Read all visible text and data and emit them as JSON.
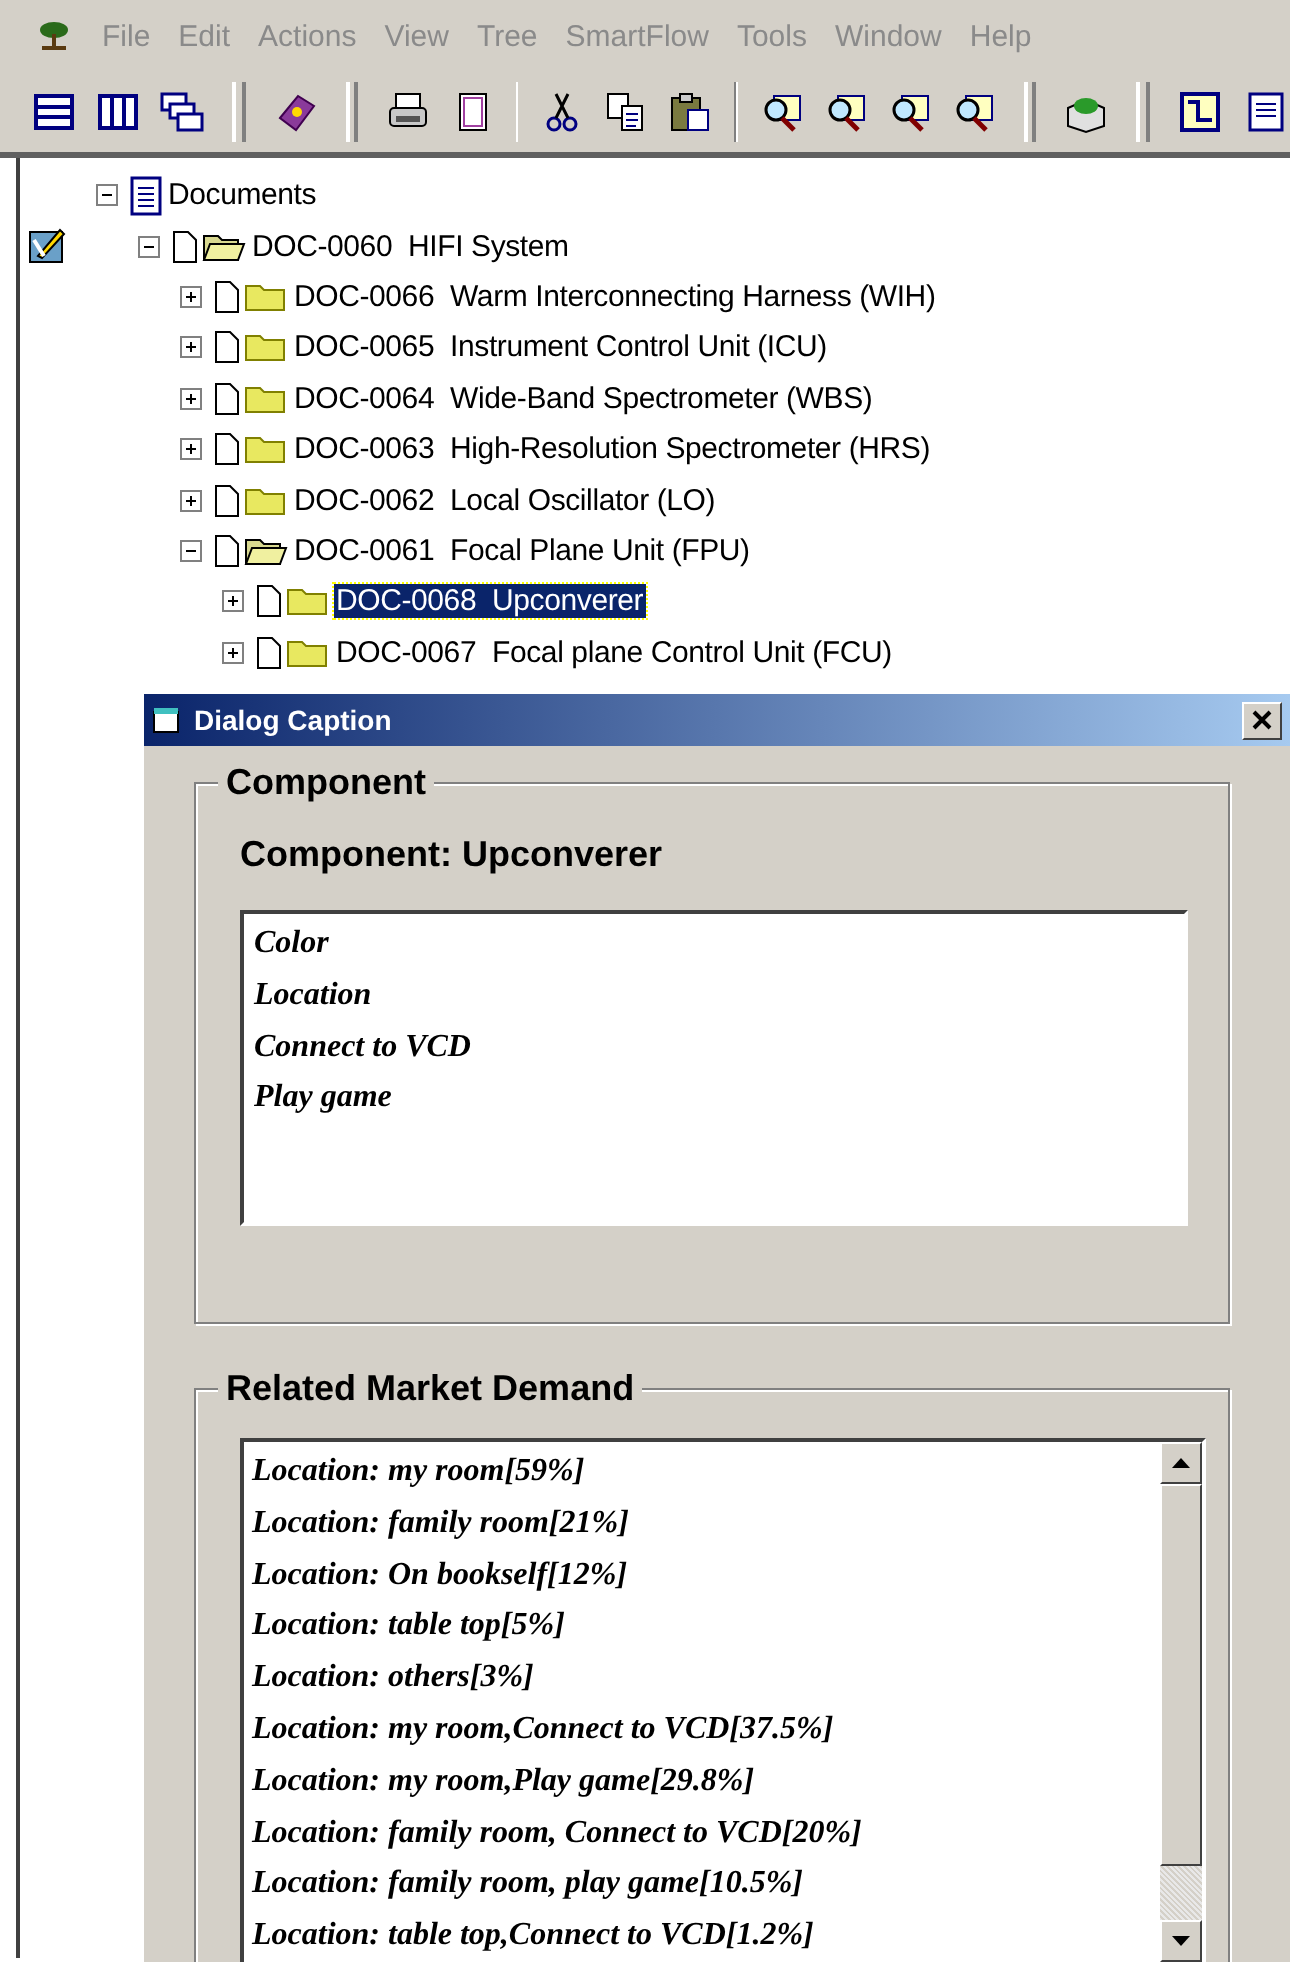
{
  "menu_bar": {
    "items": [
      {
        "label": "File",
        "disabled": true
      },
      {
        "label": "Edit",
        "disabled": true
      },
      {
        "label": "Actions",
        "disabled": true
      },
      {
        "label": "View",
        "disabled": true
      },
      {
        "label": "Tree",
        "disabled": true
      },
      {
        "label": "SmartFlow",
        "disabled": true
      },
      {
        "label": "Tools",
        "disabled": true
      },
      {
        "label": "Window",
        "disabled": true
      },
      {
        "label": "Help",
        "disabled": true
      }
    ]
  },
  "tree": {
    "items": [
      {
        "label": "Documents",
        "kind": "root",
        "expanded": true,
        "selected": false,
        "children": [
          {
            "label": "DOC-0060  HIFI System",
            "kind": "folder",
            "expanded": true,
            "selected": false,
            "children": [
              {
                "label": "DOC-0066  Warm Interconnecting Harness (WIH)",
                "kind": "folder",
                "expanded": false,
                "selected": false
              },
              {
                "label": "DOC-0065  Instrument Control Unit (ICU)",
                "kind": "folder",
                "expanded": false,
                "selected": false
              },
              {
                "label": "DOC-0064  Wide-Band Spectrometer (WBS)",
                "kind": "folder",
                "expanded": false,
                "selected": false
              },
              {
                "label": "DOC-0063  High-Resolution Spectrometer (HRS)",
                "kind": "folder",
                "expanded": false,
                "selected": false
              },
              {
                "label": "DOC-0062  Local Oscillator (LO)",
                "kind": "folder",
                "expanded": false,
                "selected": false
              },
              {
                "label": "DOC-0061  Focal Plane Unit (FPU)",
                "kind": "folder",
                "expanded": true,
                "selected": false,
                "children": [
                  {
                    "label": "DOC-0068  Upconverer",
                    "kind": "folder",
                    "expanded": false,
                    "selected": true
                  },
                  {
                    "label": "DOC-0067  Focal plane Control Unit (FCU)",
                    "kind": "folder",
                    "expanded": false,
                    "selected": false
                  }
                ]
              }
            ]
          }
        ]
      }
    ]
  },
  "dialog": {
    "title": "Dialog Caption",
    "component_group": {
      "legend": "Component",
      "label": "Component: Upconverer",
      "items": [
        "Color",
        "Location",
        "Connect to VCD",
        "Play game"
      ]
    },
    "demand_group": {
      "legend": "Related Market Demand",
      "items": [
        "Location: my room[59%]",
        "Location: family room[21%]",
        "Location: On bookself[12%]",
        "Location: table top[5%]",
        "Location: others[3%]",
        "Location: my room,Connect to VCD[37.5%]",
        "Location: my room,Play game[29.8%]",
        "Location: family room, Connect to VCD[20%]",
        "Location: family room, play game[10.5%]",
        "Location: table top,Connect to VCD[1.2%]"
      ]
    }
  }
}
